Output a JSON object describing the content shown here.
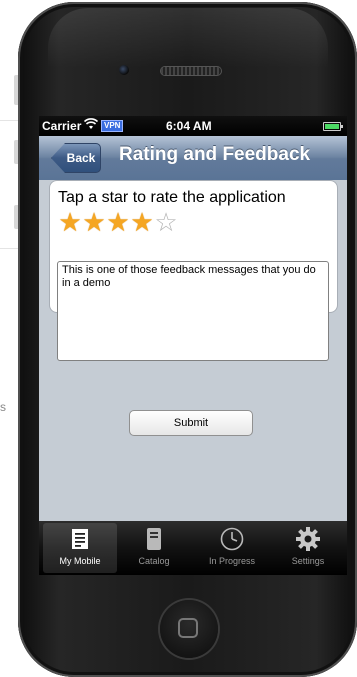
{
  "background": {
    "partial_text": "s"
  },
  "status_bar": {
    "carrier": "Carrier",
    "vpn": "VPN",
    "time": "6:04 AM"
  },
  "nav": {
    "back_label": "Back",
    "title": "Rating and Feedback"
  },
  "rating": {
    "prompt": "Tap a star to rate the application",
    "stars_filled": 4,
    "stars_total": 5
  },
  "feedback": {
    "value": "This is one of those feedback messages that you do in a demo"
  },
  "submit_label": "Submit",
  "tabs": [
    {
      "label": "My Mobile",
      "icon": "document-icon",
      "active": true
    },
    {
      "label": "Catalog",
      "icon": "book-icon",
      "active": false
    },
    {
      "label": "In Progress",
      "icon": "clock-icon",
      "active": false
    },
    {
      "label": "Settings",
      "icon": "gear-icon",
      "active": false
    }
  ],
  "colors": {
    "navbar": "#6d84a2",
    "star_on": "#f5a623",
    "star_off": "#b5b5b5",
    "screen_bg": "#c5ccd4"
  }
}
